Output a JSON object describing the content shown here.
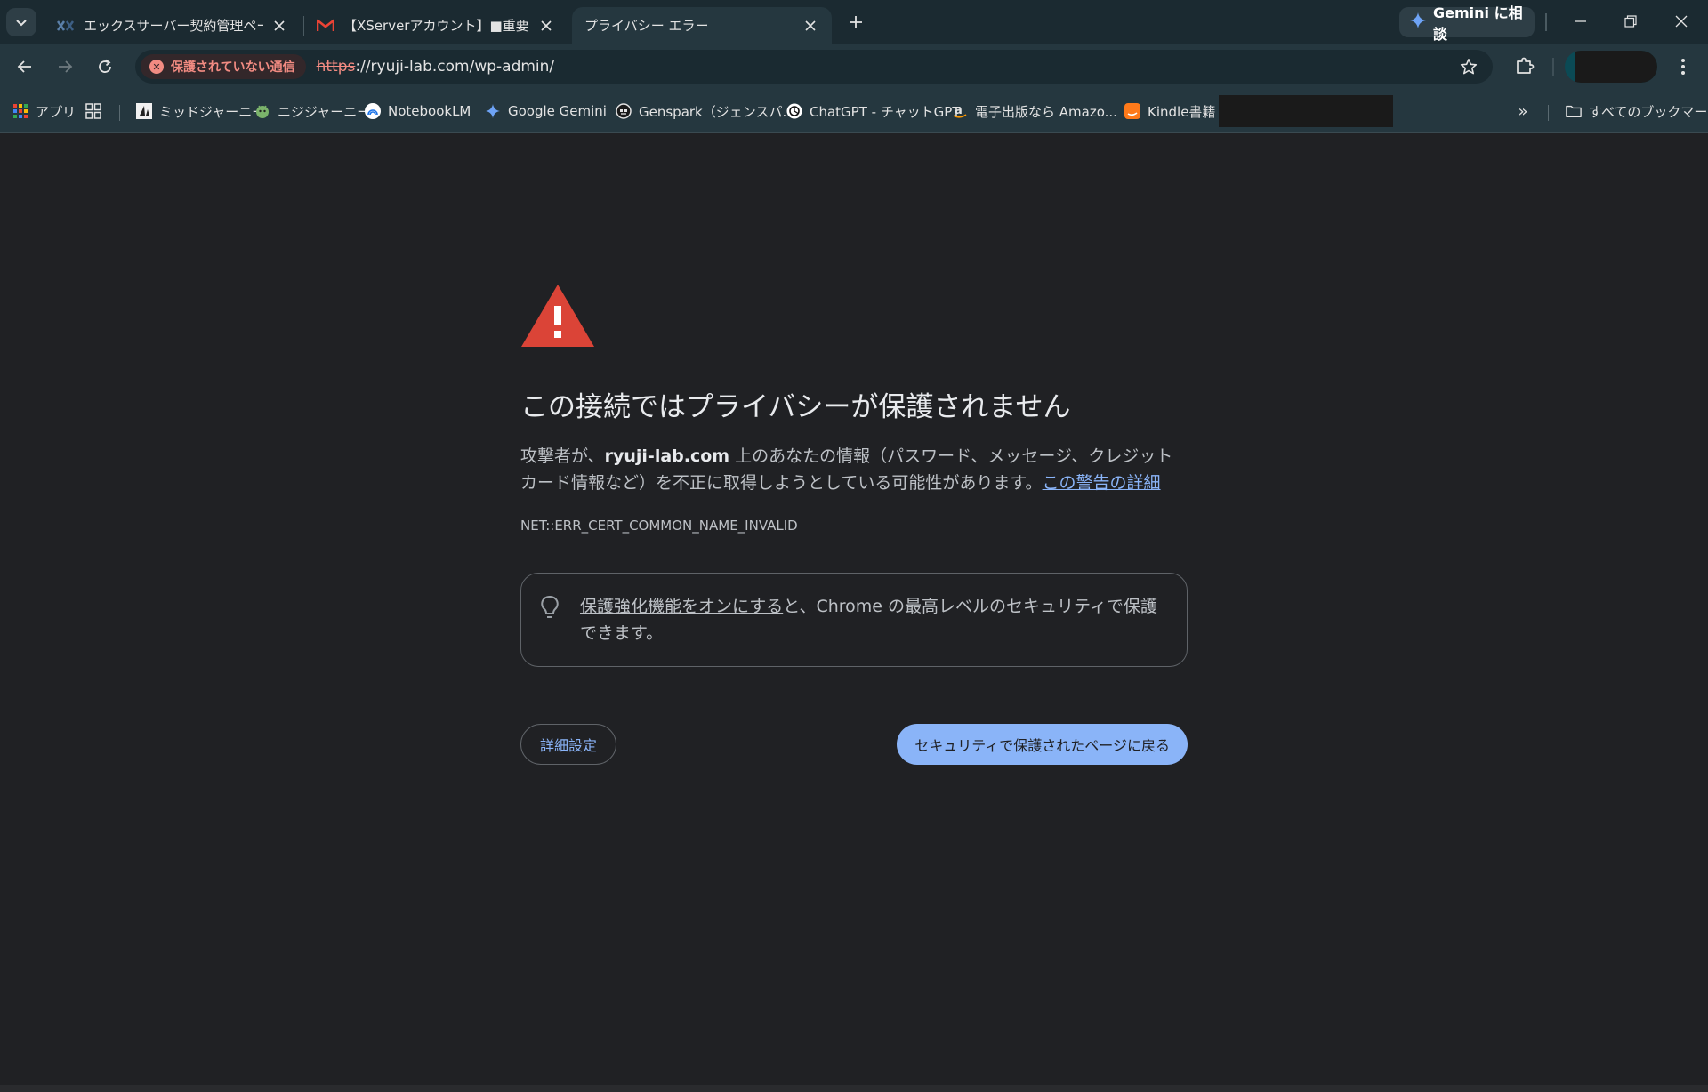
{
  "tabs": [
    {
      "title": "エックスサーバー契約管理ページ",
      "active": false
    },
    {
      "title": "【XServerアカウント】■重要■サー",
      "active": false
    },
    {
      "title": "プライバシー エラー",
      "active": true
    }
  ],
  "gemini_button": "Gemini に相談",
  "security_chip": "保護されていない通信",
  "url": {
    "scheme": "https",
    "rest": "://ryuji-lab.com/wp-admin/"
  },
  "bookmarks": [
    {
      "label": "アプリ",
      "icon": "apps-grid-icon"
    },
    {
      "label": "",
      "icon": "tab-groups-icon"
    },
    {
      "label": "ミッドジャーニー",
      "icon": "midjourney-icon"
    },
    {
      "label": "ニジジャーニー",
      "icon": "nijijourney-icon"
    },
    {
      "label": "NotebookLM",
      "icon": "notebooklm-icon"
    },
    {
      "label": "Google Gemini",
      "icon": "gemini-icon"
    },
    {
      "label": "Genspark（ジェンスパ...",
      "icon": "genspark-icon"
    },
    {
      "label": "ChatGPT - チャットGPT",
      "icon": "chatgpt-icon"
    },
    {
      "label": "電子出版なら Amazo...",
      "icon": "amazon-icon"
    },
    {
      "label": "Kindle書籍",
      "icon": "kindle-icon"
    }
  ],
  "all_bookmarks": "すべてのブックマーク",
  "page": {
    "heading": "この接続ではプライバシーが保護されません",
    "desc_before": "攻撃者が、",
    "desc_domain": "ryuji-lab.com",
    "desc_after": " 上のあなたの情報（パスワード、メッセージ、クレジット カード情報など）を不正に取得しようとしている可能性があります。",
    "desc_link": "この警告の詳細",
    "error_code": "NET::ERR_CERT_COMMON_NAME_INVALID",
    "hint_link": "保護強化機能をオンにする",
    "hint_rest": "と、Chrome の最高レベルのセキュリティで保護できます。",
    "advanced_button": "詳細設定",
    "back_button": "セキュリティで保護されたページに戻る"
  },
  "colors": {
    "background": "#202124",
    "warning_red": "#db4437",
    "link_blue": "#8ab4f8",
    "insecure_red": "#f28b82"
  }
}
